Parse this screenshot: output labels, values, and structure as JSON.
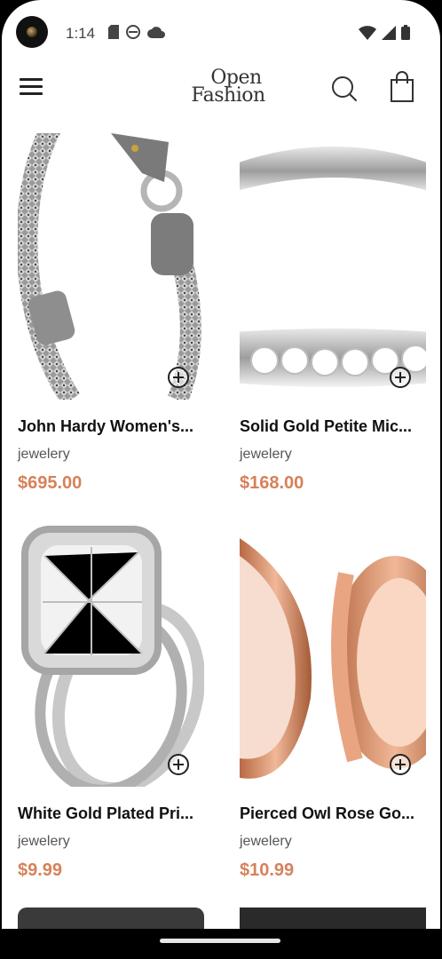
{
  "status_bar": {
    "time": "1:14"
  },
  "header": {
    "logo_line1": "Open",
    "logo_line2": "Fashion"
  },
  "products": [
    {
      "name": "John Hardy Women's...",
      "category": "jewelery",
      "price": "$695.00"
    },
    {
      "name": "Solid Gold Petite Mic...",
      "category": "jewelery",
      "price": "$168.00"
    },
    {
      "name": "White Gold Plated Pri...",
      "category": "jewelery",
      "price": "$9.99"
    },
    {
      "name": "Pierced Owl Rose Go...",
      "category": "jewelery",
      "price": "$10.99"
    }
  ],
  "colors": {
    "price": "#d7815a",
    "text": "#111111",
    "muted": "#555555"
  },
  "icons": {
    "menu": "hamburger-menu-icon",
    "search": "search-icon",
    "cart": "shopping-bag-icon",
    "add": "plus-circle-icon"
  }
}
